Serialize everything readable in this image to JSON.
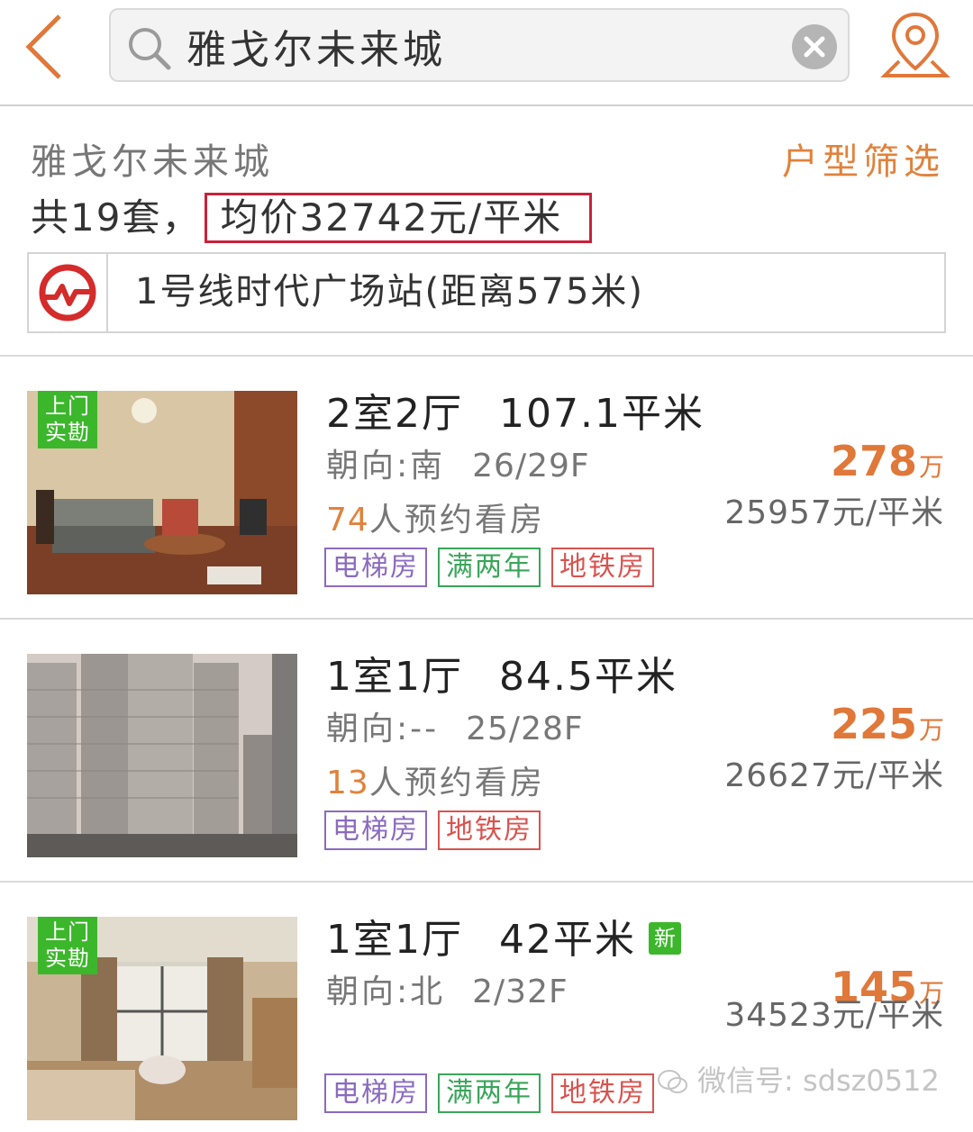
{
  "search": {
    "value": "雅戈尔未来城"
  },
  "summary": {
    "estate_name": "雅戈尔未来城",
    "filter_label": "户型筛选",
    "count_text": "共19套，",
    "avg_price_text": "均价32742元/平米",
    "metro_text": "1号线时代广场站(距离575米)"
  },
  "listings": [
    {
      "badge": [
        "上门",
        "实勘"
      ],
      "rooms": "2室2厅",
      "area": "107.1平米",
      "new_tag": "",
      "orientation": "朝向:南",
      "floor": "26/29F",
      "visit_count": "74",
      "visit_suffix": "人预约看房",
      "tags": [
        "电梯房",
        "满两年",
        "地铁房"
      ],
      "price": "278",
      "price_unit": "万",
      "unit_price": "25957元/平米"
    },
    {
      "badge": [],
      "rooms": "1室1厅",
      "area": "84.5平米",
      "new_tag": "",
      "orientation": "朝向:--",
      "floor": "25/28F",
      "visit_count": "13",
      "visit_suffix": "人预约看房",
      "tags": [
        "电梯房",
        "地铁房"
      ],
      "price": "225",
      "price_unit": "万",
      "unit_price": "26627元/平米"
    },
    {
      "badge": [
        "上门",
        "实勘"
      ],
      "rooms": "1室1厅",
      "area": "42平米",
      "new_tag": "新",
      "orientation": "朝向:北",
      "floor": "2/32F",
      "visit_count": "",
      "visit_suffix": "",
      "tags": [
        "电梯房",
        "满两年",
        "地铁房"
      ],
      "price": "145",
      "price_unit": "万",
      "unit_price": "34523元/平米"
    }
  ],
  "watermark": "微信号: sdsz0512",
  "colors": {
    "accent_orange": "#e0783a",
    "badge_green": "#3cb72b",
    "avg_box_red": "#c8223a",
    "tag_elevator": "#8a6bbf",
    "tag_two_years": "#3aa55a",
    "tag_metro": "#d9534f"
  },
  "icons": {
    "back": "chevron-left-icon",
    "search": "search-icon",
    "clear": "clear-icon",
    "location": "location-pin-icon",
    "metro": "metro-logo-icon"
  }
}
